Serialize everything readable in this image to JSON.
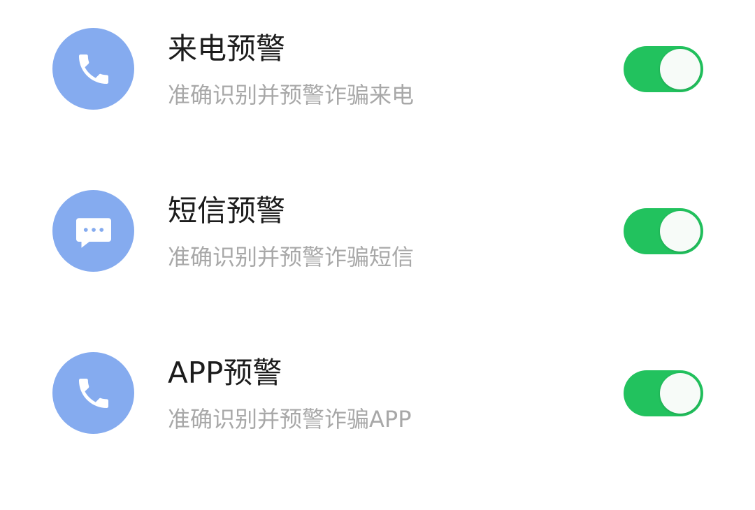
{
  "colors": {
    "icon_circle": "#85abef",
    "icon_glyph": "#ffffff",
    "toggle_on": "#22c25e",
    "title": "#1c1c1c",
    "subtitle": "#a8a8a8"
  },
  "settings": [
    {
      "title": "来电预警",
      "subtitle": "准确识别并预警诈骗来电",
      "icon": "phone-icon",
      "enabled": true
    },
    {
      "title": "短信预警",
      "subtitle": "准确识别并预警诈骗短信",
      "icon": "message-icon",
      "enabled": true
    },
    {
      "title": "APP预警",
      "subtitle": "准确识别并预警诈骗APP",
      "icon": "phone-icon",
      "enabled": true
    }
  ]
}
